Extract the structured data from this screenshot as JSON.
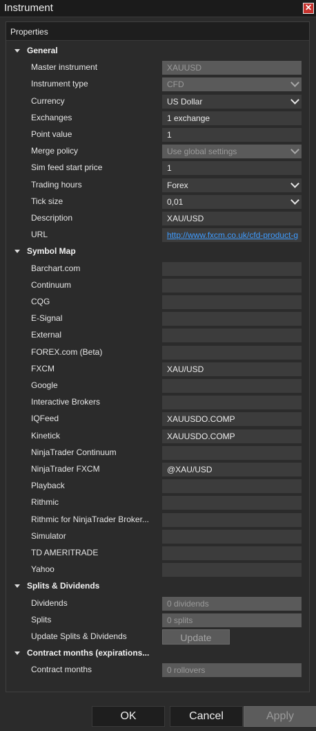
{
  "window": {
    "title": "Instrument"
  },
  "properties_header": "Properties",
  "categories": {
    "general": "General",
    "symbol_map": "Symbol Map",
    "splits": "Splits & Dividends",
    "contract": "Contract months (expirations..."
  },
  "general": [
    {
      "label": "Master instrument",
      "value": "XAUUSD",
      "disabled": true,
      "dropdown": false
    },
    {
      "label": "Instrument type",
      "value": "CFD",
      "disabled": true,
      "dropdown": true
    },
    {
      "label": "Currency",
      "value": "US Dollar",
      "disabled": false,
      "dropdown": true
    },
    {
      "label": "Exchanges",
      "value": "1 exchange",
      "disabled": false,
      "dropdown": false
    },
    {
      "label": "Point value",
      "value": "1",
      "disabled": false,
      "dropdown": false
    },
    {
      "label": "Merge policy",
      "value": "Use global settings",
      "disabled": true,
      "dropdown": true
    },
    {
      "label": "Sim feed start price",
      "value": "1",
      "disabled": false,
      "dropdown": false
    },
    {
      "label": "Trading hours",
      "value": "Forex",
      "disabled": false,
      "dropdown": true
    },
    {
      "label": "Tick size",
      "value": "0,01",
      "disabled": false,
      "dropdown": true
    },
    {
      "label": "Description",
      "value": "XAU/USD",
      "disabled": false,
      "dropdown": false
    },
    {
      "label": "URL",
      "value": "http://www.fxcm.co.uk/cfd-product-g",
      "disabled": false,
      "dropdown": false,
      "link": true
    }
  ],
  "symbol_map": [
    {
      "label": "Barchart.com",
      "value": ""
    },
    {
      "label": "Continuum",
      "value": ""
    },
    {
      "label": "CQG",
      "value": ""
    },
    {
      "label": "E-Signal",
      "value": ""
    },
    {
      "label": "External",
      "value": ""
    },
    {
      "label": "FOREX.com (Beta)",
      "value": ""
    },
    {
      "label": "FXCM",
      "value": "XAU/USD"
    },
    {
      "label": "Google",
      "value": ""
    },
    {
      "label": "Interactive Brokers",
      "value": ""
    },
    {
      "label": "IQFeed",
      "value": "XAUUSDO.COMP"
    },
    {
      "label": "Kinetick",
      "value": "XAUUSDO.COMP"
    },
    {
      "label": "NinjaTrader Continuum",
      "value": ""
    },
    {
      "label": "NinjaTrader FXCM",
      "value": "@XAU/USD"
    },
    {
      "label": "Playback",
      "value": ""
    },
    {
      "label": "Rithmic",
      "value": ""
    },
    {
      "label": "Rithmic for NinjaTrader Broker...",
      "value": ""
    },
    {
      "label": "Simulator",
      "value": ""
    },
    {
      "label": "TD AMERITRADE",
      "value": ""
    },
    {
      "label": "Yahoo",
      "value": ""
    }
  ],
  "splits": {
    "dividends_label": "Dividends",
    "dividends_value": "0 dividends",
    "splits_label": "Splits",
    "splits_value": "0 splits",
    "update_label": "Update Splits & Dividends",
    "update_button": "Update"
  },
  "contract": {
    "label": "Contract months",
    "value": "0 rollovers"
  },
  "buttons": {
    "ok": "OK",
    "cancel": "Cancel",
    "apply": "Apply"
  }
}
